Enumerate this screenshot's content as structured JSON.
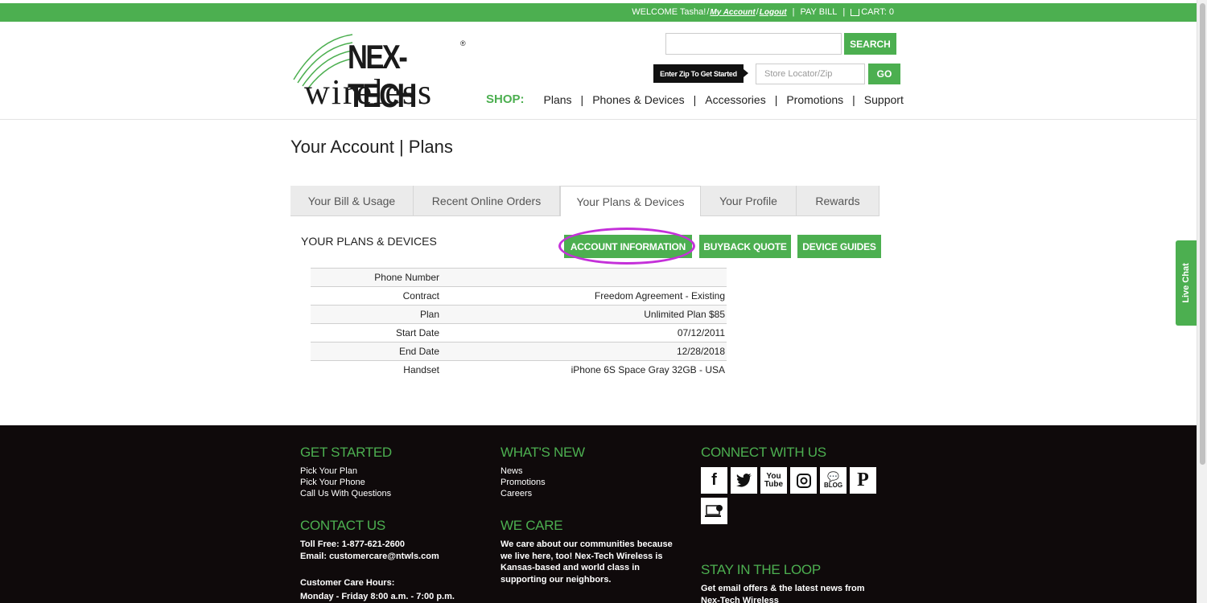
{
  "topbar": {
    "welcome": "WELCOME Tasha!",
    "my_account": "My Account",
    "logout": "Logout",
    "pay_bill": "PAY BILL",
    "cart": "CART: 0"
  },
  "header": {
    "logo_top": "NEX-TECH",
    "logo_bottom": "wireless",
    "search_button": "SEARCH",
    "zip_label": "Enter Zip To Get Started",
    "zip_placeholder": "Store Locator/Zip",
    "go_button": "GO",
    "shop_label": "SHOP:",
    "nav": [
      "Plans",
      "Phones & Devices",
      "Accessories",
      "Promotions",
      "Support"
    ]
  },
  "main": {
    "title": "Your Account | Plans",
    "tabs": [
      "Your Bill & Usage",
      "Recent Online Orders",
      "Your Plans & Devices",
      "Your Profile",
      "Rewards"
    ],
    "section_title": "YOUR PLANS & DEVICES",
    "buttons": {
      "account_info": "ACCOUNT INFORMATION",
      "buyback": "BUYBACK QUOTE",
      "device_guides": "DEVICE GUIDES"
    },
    "table": [
      {
        "label": "Phone Number",
        "value": ""
      },
      {
        "label": "Contract",
        "value": "Freedom Agreement - Existing"
      },
      {
        "label": "Plan",
        "value": "Unlimited Plan $85"
      },
      {
        "label": "Start Date",
        "value": "07/12/2011"
      },
      {
        "label": "End Date",
        "value": "12/28/2018"
      },
      {
        "label": "Handset",
        "value": "iPhone 6S Space Gray 32GB - USA"
      }
    ]
  },
  "livechat": "Live Chat",
  "footer": {
    "get_started": {
      "heading": "GET STARTED",
      "links": [
        "Pick Your Plan",
        "Pick Your Phone",
        "Call Us With Questions"
      ]
    },
    "whats_new": {
      "heading": "WHAT'S NEW",
      "links": [
        "News",
        "Promotions",
        "Careers"
      ]
    },
    "connect": {
      "heading": "CONNECT WITH US",
      "icons": [
        "facebook-icon",
        "twitter-icon",
        "youtube-icon",
        "instagram-icon",
        "blog-icon",
        "pinterest-icon",
        "chat-icon"
      ],
      "youtube_text": "You Tube",
      "blog_text": "BLOG"
    },
    "contact": {
      "heading": "CONTACT US",
      "toll_free": "Toll Free: 1-877-621-2600",
      "email": "Email: customercare@ntwls.com",
      "hours_label": "Customer Care Hours:",
      "hours": "Monday - Friday 8:00 a.m. - 7:00 p.m."
    },
    "we_care": {
      "heading": "WE CARE",
      "text": "We care about our communities because we live here, too! Nex-Tech Wireless is Kansas-based and world class in supporting our neighbors."
    },
    "loop": {
      "heading": "STAY IN THE LOOP",
      "text": "Get email offers & the latest news from Nex-Tech Wireless"
    }
  },
  "colors": {
    "brand_green": "#4caf50",
    "footer_bg": "#0f0a0b",
    "highlight": "#c430d9"
  }
}
